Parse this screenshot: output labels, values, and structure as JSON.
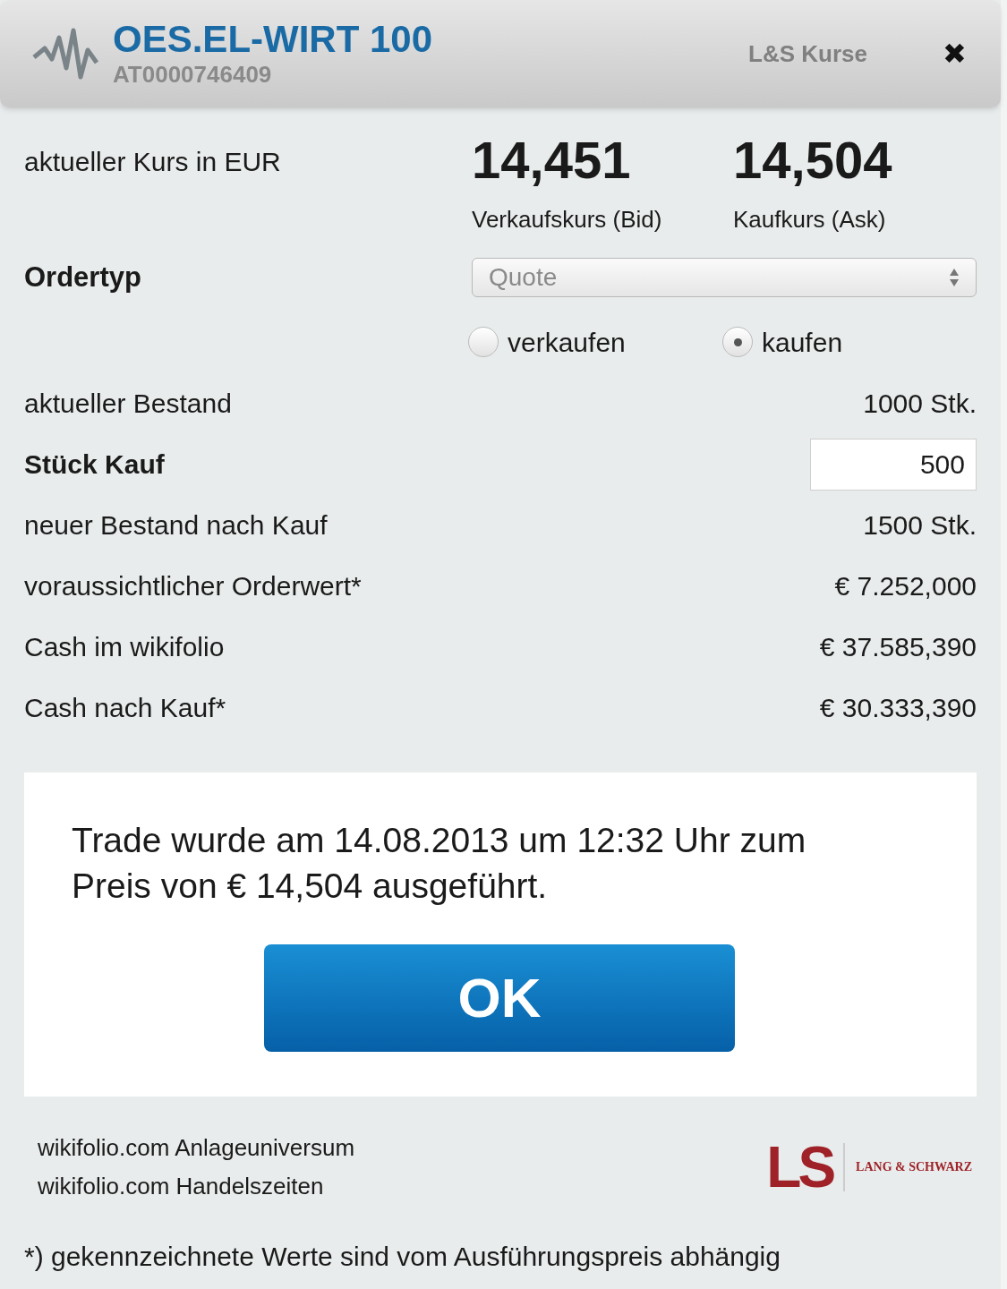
{
  "header": {
    "title": "OES.EL-WIRT 100",
    "isin": "AT0000746409",
    "source_link": "L&S Kurse",
    "close": "✖"
  },
  "quote": {
    "label": "aktueller Kurs in EUR",
    "bid": "14,451",
    "ask": "14,504",
    "bid_label": "Verkaufskurs (Bid)",
    "ask_label": "Kaufkurs (Ask)"
  },
  "ordertype": {
    "label": "Ordertyp",
    "value": "Quote"
  },
  "sides": [
    {
      "label": "verkaufen",
      "selected": false
    },
    {
      "label": "kaufen",
      "selected": true
    }
  ],
  "rows": [
    {
      "kind": "text",
      "label": "aktueller Bestand",
      "bold": false,
      "value": "1000 Stk."
    },
    {
      "kind": "input",
      "label": "Stück Kauf",
      "bold": true,
      "value": "500"
    },
    {
      "kind": "text",
      "label": "neuer Bestand nach Kauf",
      "bold": false,
      "value": "1500 Stk."
    },
    {
      "kind": "text",
      "label": "voraussichtlicher Orderwert*",
      "bold": false,
      "value": "€ 7.252,000"
    },
    {
      "kind": "text",
      "label": "Cash im wikifolio",
      "bold": false,
      "value": "€ 37.585,390"
    },
    {
      "kind": "text",
      "label": "Cash nach Kauf*",
      "bold": false,
      "value": "€ 30.333,390"
    }
  ],
  "notice": {
    "message": "Trade wurde am 14.08.2013 um 12:32 Uhr zum Preis von € 14,504 ausgeführt.",
    "button": "OK"
  },
  "links": [
    "wikifolio.com Anlageuniversum",
    "wikifolio.com Handelszeiten"
  ],
  "logo": {
    "mark": "LS",
    "name": "LANG & SCHWARZ"
  },
  "footnote": "*) gekennzeichnete Werte sind vom Ausführungspreis abhängig"
}
